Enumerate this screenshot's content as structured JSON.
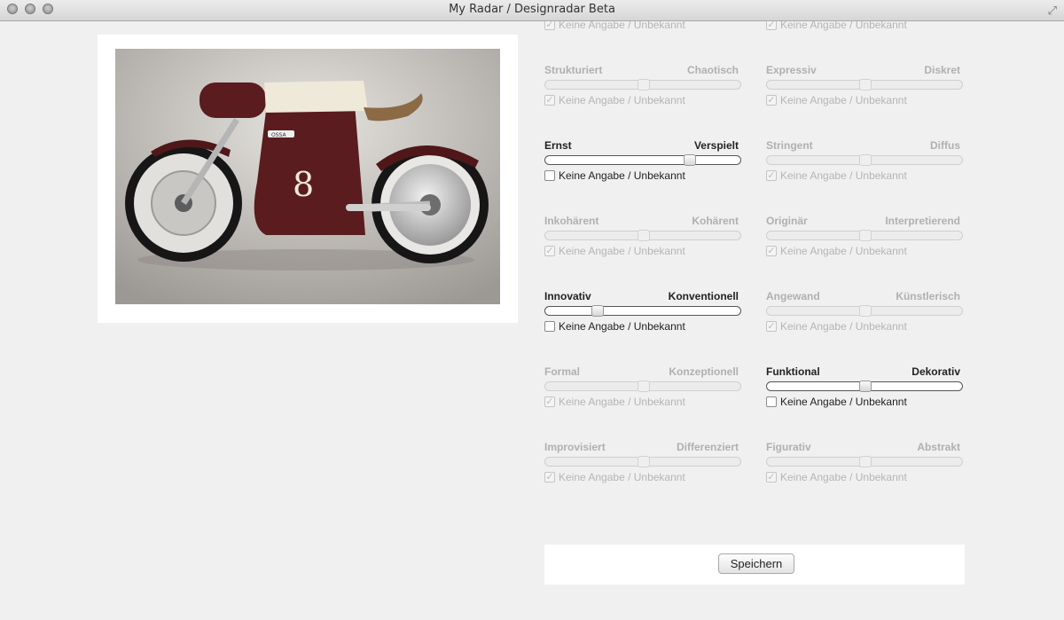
{
  "window": {
    "title": "My Radar / Designradar Beta"
  },
  "checkbox_label": "Keine Angabe / Unbekannt",
  "sliders": [
    {
      "left": "",
      "right": "",
      "enabled": false,
      "value": 0.5,
      "checked": true,
      "column": 1,
      "row": -1
    },
    {
      "left": "",
      "right": "",
      "enabled": false,
      "value": 0.5,
      "checked": true,
      "column": 2,
      "row": -1
    },
    {
      "left": "Strukturiert",
      "right": "Chaotisch",
      "enabled": false,
      "value": 0.5,
      "checked": true,
      "column": 1,
      "row": 0
    },
    {
      "left": "Expressiv",
      "right": "Diskret",
      "enabled": false,
      "value": 0.5,
      "checked": true,
      "column": 2,
      "row": 0
    },
    {
      "left": "Ernst",
      "right": "Verspielt",
      "enabled": true,
      "value": 0.75,
      "checked": false,
      "column": 1,
      "row": 1
    },
    {
      "left": "Stringent",
      "right": "Diffus",
      "enabled": false,
      "value": 0.5,
      "checked": true,
      "column": 2,
      "row": 1
    },
    {
      "left": "Inkohärent",
      "right": "Kohärent",
      "enabled": false,
      "value": 0.5,
      "checked": true,
      "column": 1,
      "row": 2
    },
    {
      "left": "Originär",
      "right": "Interpretierend",
      "enabled": false,
      "value": 0.5,
      "checked": true,
      "column": 2,
      "row": 2
    },
    {
      "left": "Innovativ",
      "right": "Konventionell",
      "enabled": true,
      "value": 0.25,
      "checked": false,
      "column": 1,
      "row": 3
    },
    {
      "left": "Angewand",
      "right": "Künstlerisch",
      "enabled": false,
      "value": 0.5,
      "checked": true,
      "column": 2,
      "row": 3
    },
    {
      "left": "Formal",
      "right": "Konzeptionell",
      "enabled": false,
      "value": 0.5,
      "checked": true,
      "column": 1,
      "row": 4
    },
    {
      "left": "Funktional",
      "right": "Dekorativ",
      "enabled": true,
      "value": 0.5,
      "checked": false,
      "column": 2,
      "row": 4
    },
    {
      "left": "Improvisiert",
      "right": "Differenziert",
      "enabled": false,
      "value": 0.5,
      "checked": true,
      "column": 1,
      "row": 5
    },
    {
      "left": "Figurativ",
      "right": "Abstrakt",
      "enabled": false,
      "value": 0.5,
      "checked": true,
      "column": 2,
      "row": 5
    }
  ],
  "save_label": "Speichern",
  "photo": {
    "badge": "OSSA",
    "number": "8"
  },
  "colors": {
    "frame": "#ffffff",
    "bike_body": "#5a1c1e",
    "seat": "#8b6a45",
    "background": "#f0f0f0"
  }
}
